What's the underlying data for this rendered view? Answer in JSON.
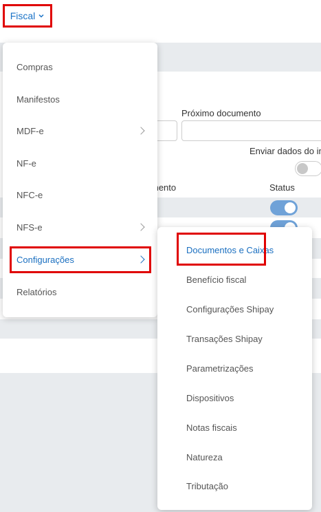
{
  "header": {
    "menu_label": "Fiscal"
  },
  "background": {
    "next_document_label": "Próximo documento",
    "send_data_label": "Enviar dados do in",
    "table_col_document": "mento",
    "table_col_status": "Status"
  },
  "main_menu": {
    "items": [
      {
        "label": "Compras",
        "has_submenu": false
      },
      {
        "label": "Manifestos",
        "has_submenu": false
      },
      {
        "label": "MDF-e",
        "has_submenu": true
      },
      {
        "label": "NF-e",
        "has_submenu": false
      },
      {
        "label": "NFC-e",
        "has_submenu": false
      },
      {
        "label": "NFS-e",
        "has_submenu": true
      },
      {
        "label": "Configurações",
        "has_submenu": true,
        "active": true
      },
      {
        "label": "Relatórios",
        "has_submenu": false
      }
    ]
  },
  "sub_menu": {
    "items": [
      {
        "label": "Documentos e Caixas",
        "active": true
      },
      {
        "label": "Benefício fiscal"
      },
      {
        "label": "Configurações Shipay"
      },
      {
        "label": "Transações Shipay"
      },
      {
        "label": "Parametrizações"
      },
      {
        "label": "Dispositivos"
      },
      {
        "label": "Notas fiscais"
      },
      {
        "label": "Natureza"
      },
      {
        "label": "Tributação"
      }
    ]
  },
  "colors": {
    "accent": "#1a6fc0",
    "highlight_border": "#e00000",
    "toggle_on": "#6fa2d8",
    "page_bg": "#e8ebee"
  }
}
